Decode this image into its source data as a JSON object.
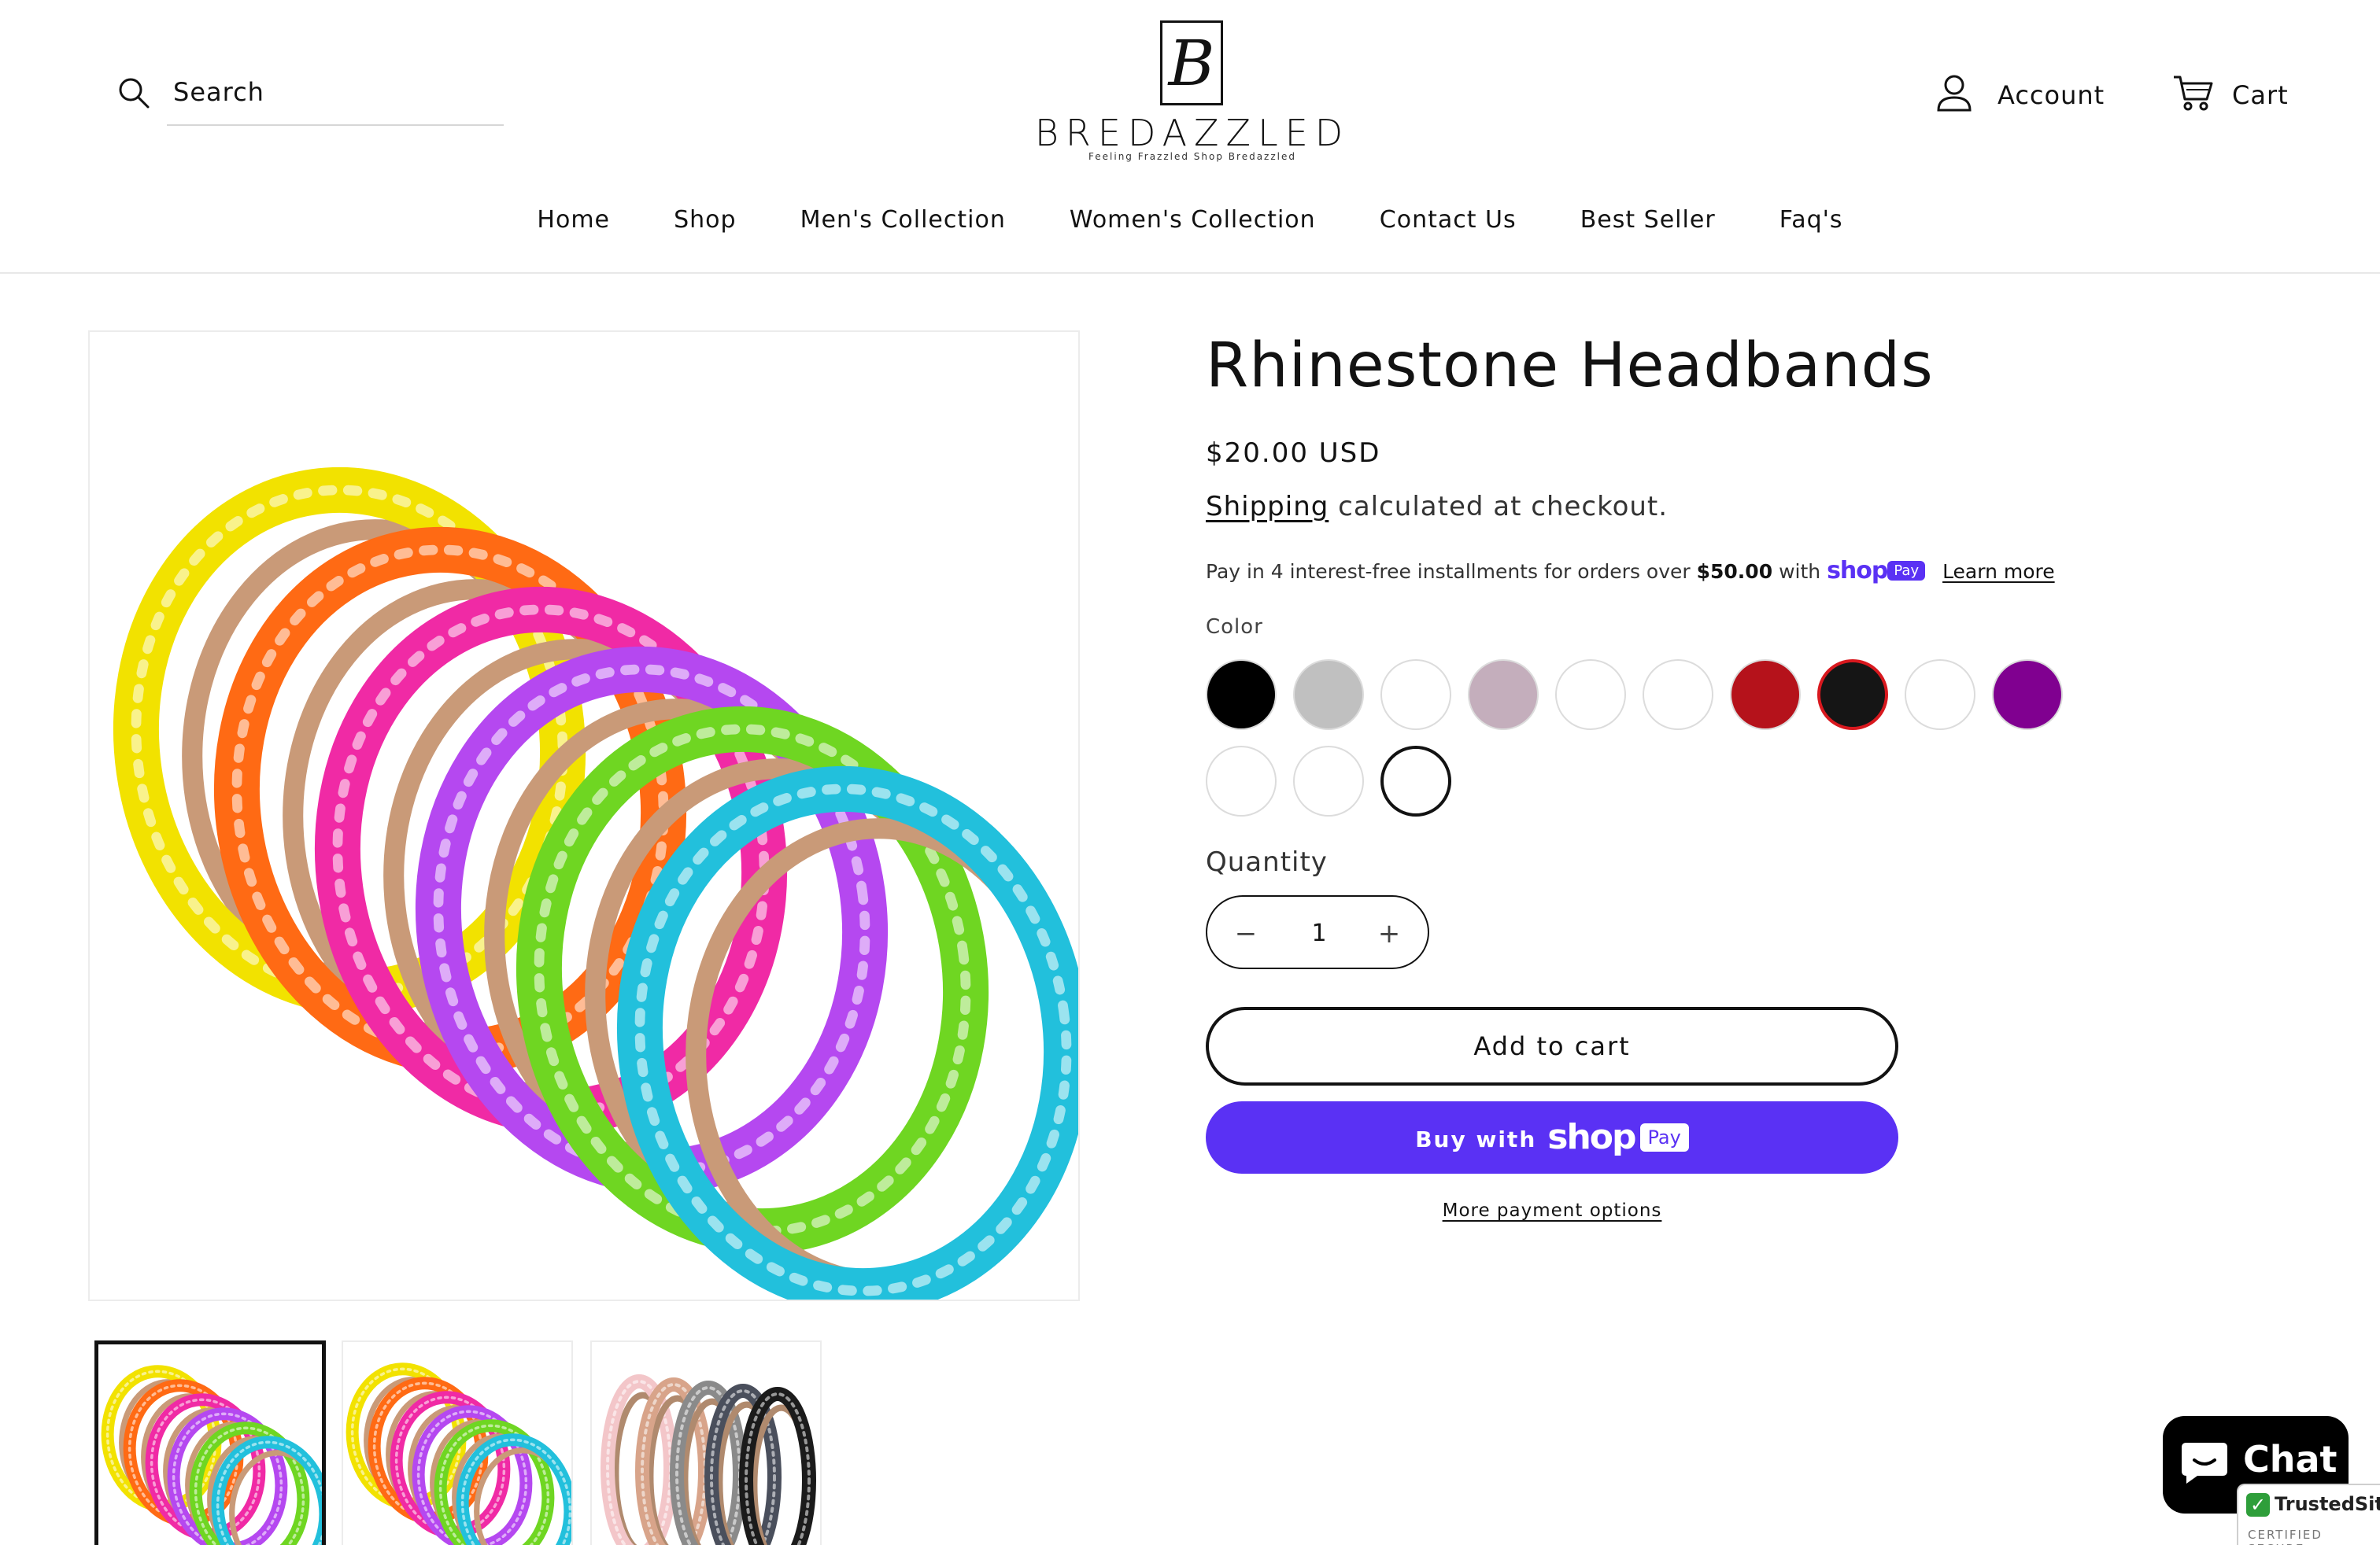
{
  "header": {
    "search_label": "Search",
    "logo_letter": "B",
    "brand_name": "BREDAZZLED",
    "brand_tagline": "Feeling Frazzled Shop Bredazzled",
    "account_label": "Account",
    "cart_label": "Cart"
  },
  "nav": {
    "items": [
      "Home",
      "Shop",
      "Men's Collection",
      "Women's Collection",
      "Contact Us",
      "Best Seller",
      "Faq's"
    ]
  },
  "product": {
    "title": "Rhinestone Headbands",
    "price": "$20.00 USD",
    "shipping_link": "Shipping",
    "shipping_rest": "calculated at checkout.",
    "installments_text": "Pay in 4 interest-free installments for orders over",
    "installments_amount": "$50.00",
    "installments_with": "with",
    "shop_word": "shop",
    "pay_word": "Pay",
    "learn_more": "Learn more",
    "color_label": "Color",
    "swatch_colors": [
      "#000000",
      "#c0c0c0",
      "#ffffff",
      "#c4aebc",
      "#ffffff",
      "#ffffff",
      "#b5121b",
      "#151515",
      "#ffffff",
      "#800090",
      "#ffffff",
      "#ffffff",
      "#ffffff"
    ],
    "quantity_label": "Quantity",
    "quantity_value": "1",
    "add_to_cart": "Add to cart",
    "buy_with": "Buy with",
    "more_payment_options": "More payment options"
  },
  "media": {
    "main_band_colors": [
      "#f2e200",
      "#ff6a14",
      "#f02aa5",
      "#b548f0",
      "#6fd622",
      "#22c0dc"
    ],
    "thumb_bands": [
      [
        "#f2e200",
        "#ff6a14",
        "#f02aa5",
        "#b548f0",
        "#6fd622",
        "#22c0dc"
      ],
      [
        "#f2e200",
        "#ff6a14",
        "#f02aa5",
        "#b548f0",
        "#6fd622",
        "#22c0dc"
      ],
      [
        "#f3c6c9",
        "#d8a48a",
        "#8a8a8a",
        "#4a4f5c",
        "#1b1b1b"
      ]
    ]
  },
  "chat": {
    "label": "Chat"
  },
  "badge": {
    "name": "TrustedSite",
    "sub": "CERTIFIED SECURE"
  }
}
